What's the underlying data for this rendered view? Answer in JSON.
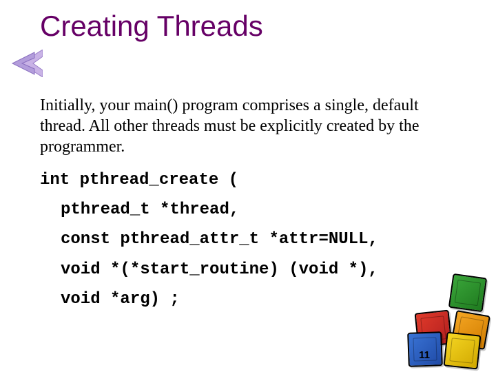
{
  "slide": {
    "title": "Creating Threads",
    "body": "Initially, your main() program comprises a single, default thread. All other threads must be explicitly created by the programmer.",
    "code": {
      "line1": "int pthread_create (",
      "line2": "pthread_t *thread,",
      "line3": "const pthread_attr_t *attr=NULL,",
      "line4": "void *(*start_routine) (void *),",
      "line5": "void *arg) ;"
    },
    "page_number": "11"
  }
}
